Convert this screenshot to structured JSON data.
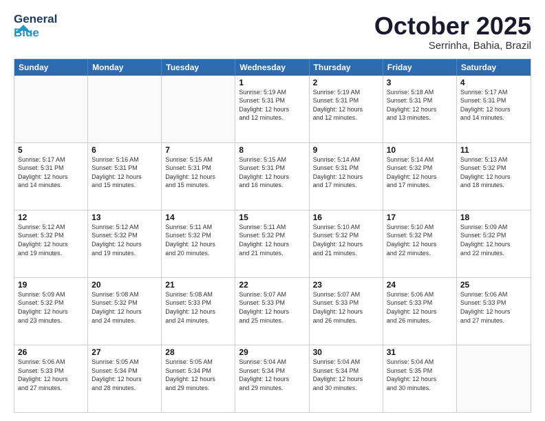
{
  "header": {
    "logo_line1": "General",
    "logo_line2": "Blue",
    "month": "October 2025",
    "location": "Serrinha, Bahia, Brazil"
  },
  "weekdays": [
    "Sunday",
    "Monday",
    "Tuesday",
    "Wednesday",
    "Thursday",
    "Friday",
    "Saturday"
  ],
  "rows": [
    [
      {
        "day": "",
        "info": ""
      },
      {
        "day": "",
        "info": ""
      },
      {
        "day": "",
        "info": ""
      },
      {
        "day": "1",
        "info": "Sunrise: 5:19 AM\nSunset: 5:31 PM\nDaylight: 12 hours\nand 12 minutes."
      },
      {
        "day": "2",
        "info": "Sunrise: 5:19 AM\nSunset: 5:31 PM\nDaylight: 12 hours\nand 12 minutes."
      },
      {
        "day": "3",
        "info": "Sunrise: 5:18 AM\nSunset: 5:31 PM\nDaylight: 12 hours\nand 13 minutes."
      },
      {
        "day": "4",
        "info": "Sunrise: 5:17 AM\nSunset: 5:31 PM\nDaylight: 12 hours\nand 14 minutes."
      }
    ],
    [
      {
        "day": "5",
        "info": "Sunrise: 5:17 AM\nSunset: 5:31 PM\nDaylight: 12 hours\nand 14 minutes."
      },
      {
        "day": "6",
        "info": "Sunrise: 5:16 AM\nSunset: 5:31 PM\nDaylight: 12 hours\nand 15 minutes."
      },
      {
        "day": "7",
        "info": "Sunrise: 5:15 AM\nSunset: 5:31 PM\nDaylight: 12 hours\nand 15 minutes."
      },
      {
        "day": "8",
        "info": "Sunrise: 5:15 AM\nSunset: 5:31 PM\nDaylight: 12 hours\nand 16 minutes."
      },
      {
        "day": "9",
        "info": "Sunrise: 5:14 AM\nSunset: 5:31 PM\nDaylight: 12 hours\nand 17 minutes."
      },
      {
        "day": "10",
        "info": "Sunrise: 5:14 AM\nSunset: 5:32 PM\nDaylight: 12 hours\nand 17 minutes."
      },
      {
        "day": "11",
        "info": "Sunrise: 5:13 AM\nSunset: 5:32 PM\nDaylight: 12 hours\nand 18 minutes."
      }
    ],
    [
      {
        "day": "12",
        "info": "Sunrise: 5:12 AM\nSunset: 5:32 PM\nDaylight: 12 hours\nand 19 minutes."
      },
      {
        "day": "13",
        "info": "Sunrise: 5:12 AM\nSunset: 5:32 PM\nDaylight: 12 hours\nand 19 minutes."
      },
      {
        "day": "14",
        "info": "Sunrise: 5:11 AM\nSunset: 5:32 PM\nDaylight: 12 hours\nand 20 minutes."
      },
      {
        "day": "15",
        "info": "Sunrise: 5:11 AM\nSunset: 5:32 PM\nDaylight: 12 hours\nand 21 minutes."
      },
      {
        "day": "16",
        "info": "Sunrise: 5:10 AM\nSunset: 5:32 PM\nDaylight: 12 hours\nand 21 minutes."
      },
      {
        "day": "17",
        "info": "Sunrise: 5:10 AM\nSunset: 5:32 PM\nDaylight: 12 hours\nand 22 minutes."
      },
      {
        "day": "18",
        "info": "Sunrise: 5:09 AM\nSunset: 5:32 PM\nDaylight: 12 hours\nand 22 minutes."
      }
    ],
    [
      {
        "day": "19",
        "info": "Sunrise: 5:09 AM\nSunset: 5:32 PM\nDaylight: 12 hours\nand 23 minutes."
      },
      {
        "day": "20",
        "info": "Sunrise: 5:08 AM\nSunset: 5:32 PM\nDaylight: 12 hours\nand 24 minutes."
      },
      {
        "day": "21",
        "info": "Sunrise: 5:08 AM\nSunset: 5:33 PM\nDaylight: 12 hours\nand 24 minutes."
      },
      {
        "day": "22",
        "info": "Sunrise: 5:07 AM\nSunset: 5:33 PM\nDaylight: 12 hours\nand 25 minutes."
      },
      {
        "day": "23",
        "info": "Sunrise: 5:07 AM\nSunset: 5:33 PM\nDaylight: 12 hours\nand 26 minutes."
      },
      {
        "day": "24",
        "info": "Sunrise: 5:06 AM\nSunset: 5:33 PM\nDaylight: 12 hours\nand 26 minutes."
      },
      {
        "day": "25",
        "info": "Sunrise: 5:06 AM\nSunset: 5:33 PM\nDaylight: 12 hours\nand 27 minutes."
      }
    ],
    [
      {
        "day": "26",
        "info": "Sunrise: 5:06 AM\nSunset: 5:33 PM\nDaylight: 12 hours\nand 27 minutes."
      },
      {
        "day": "27",
        "info": "Sunrise: 5:05 AM\nSunset: 5:34 PM\nDaylight: 12 hours\nand 28 minutes."
      },
      {
        "day": "28",
        "info": "Sunrise: 5:05 AM\nSunset: 5:34 PM\nDaylight: 12 hours\nand 29 minutes."
      },
      {
        "day": "29",
        "info": "Sunrise: 5:04 AM\nSunset: 5:34 PM\nDaylight: 12 hours\nand 29 minutes."
      },
      {
        "day": "30",
        "info": "Sunrise: 5:04 AM\nSunset: 5:34 PM\nDaylight: 12 hours\nand 30 minutes."
      },
      {
        "day": "31",
        "info": "Sunrise: 5:04 AM\nSunset: 5:35 PM\nDaylight: 12 hours\nand 30 minutes."
      },
      {
        "day": "",
        "info": ""
      }
    ]
  ]
}
